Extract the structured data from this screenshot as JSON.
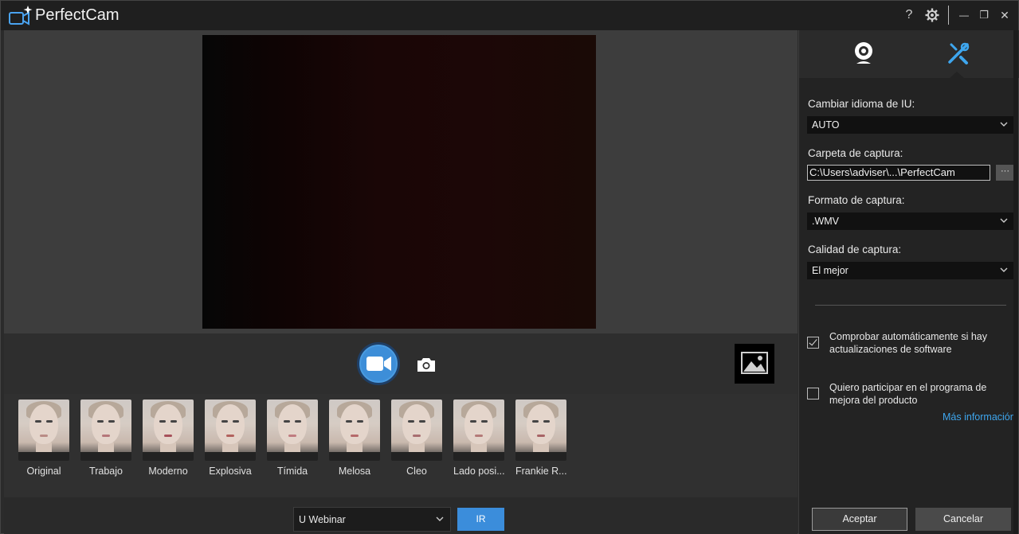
{
  "app": {
    "title": "PerfectCam"
  },
  "titlebar": {
    "help": "?",
    "settings_icon": "gear-icon",
    "minimize": "—",
    "restore": "❐",
    "close": "✕"
  },
  "filters": [
    {
      "label": "Original",
      "lip": "#b98c86"
    },
    {
      "label": "Trabajo",
      "lip": "#b5777a"
    },
    {
      "label": "Moderno",
      "lip": "#a6505a"
    },
    {
      "label": "Explosiva",
      "lip": "#b2625e"
    },
    {
      "label": "Tímida",
      "lip": "#c07c80"
    },
    {
      "label": "Melosa",
      "lip": "#b56a6a"
    },
    {
      "label": "Cleo",
      "lip": "#a86e70"
    },
    {
      "label": "Lado posi...",
      "lip": "#b47a78"
    },
    {
      "label": "Frankie R...",
      "lip": "#a86466"
    }
  ],
  "bottom": {
    "webinar_value": "U Webinar",
    "go_label": "IR"
  },
  "settings": {
    "language_label": "Cambiar idioma de IU:",
    "language_value": "AUTO",
    "folder_label": "Carpeta de captura:",
    "folder_value": "C:\\Users\\adviser\\...\\PerfectCam",
    "browse_label": "···",
    "format_label": "Formato de captura:",
    "format_value": ".WMV",
    "quality_label": "Calidad de captura:",
    "quality_value": "El mejor",
    "auto_update_text": "Comprobar automáticamente si hay actualizaciones de software",
    "auto_update_checked": true,
    "program_text": "Quiero participar en el programa de mejora del producto",
    "program_checked": false,
    "more_info": "Más información",
    "ok_label": "Aceptar",
    "cancel_label": "Cancelar"
  },
  "colors": {
    "accent": "#3b8ddb",
    "link": "#3ea6ee"
  }
}
